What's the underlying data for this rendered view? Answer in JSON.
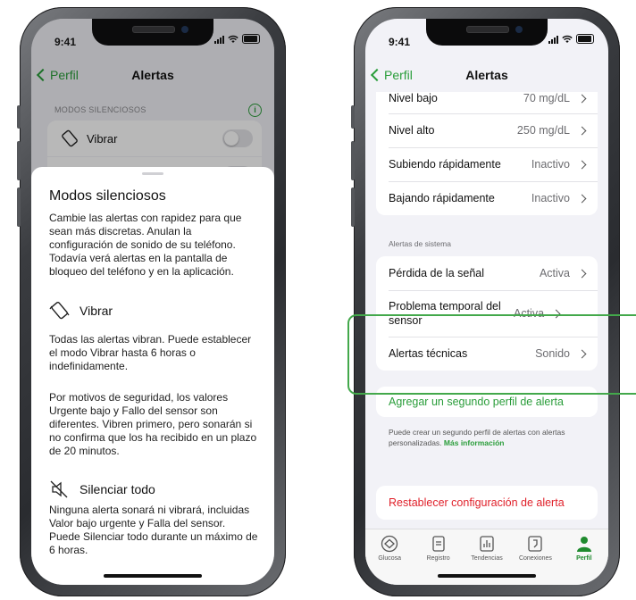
{
  "status_time": "9:41",
  "left": {
    "nav": {
      "back": "Perfil",
      "title": "Alertas"
    },
    "section_header": "MODOS SILENCIOSOS",
    "bg_row_label": "Vibrar",
    "sheet": {
      "title": "Modos silenciosos",
      "intro": "Cambie las alertas con rapidez para que sean más discretas. Anulan la configuración de sonido de su teléfono. Todavía verá alertas en la pantalla de bloqueo del teléfono y en la aplicación.",
      "vibrate_heading": "Vibrar",
      "vibrate_text": "Todas las alertas vibran. Puede establecer el modo Vibrar hasta 6 horas o indefinidamente.",
      "vibrate_note": "Por motivos de seguridad, los valores Urgente bajo y Fallo del sensor son diferentes. Vibren primero, pero sonarán si no confirma que los ha recibido en un plazo de 20 minutos.",
      "mute_heading": "Silenciar todo",
      "mute_text": "Ninguna alerta sonará ni vibrará, incluidas Valor bajo urgente y Falla del sensor. Puede Silenciar todo durante un máximo de 6 horas."
    }
  },
  "right": {
    "nav": {
      "back": "Perfil",
      "title": "Alertas"
    },
    "glucose_rows": [
      {
        "label": "Nivel bajo",
        "value": "70 mg/dL"
      },
      {
        "label": "Nivel alto",
        "value": "250 mg/dL"
      },
      {
        "label": "Subiendo rápidamente",
        "value": "Inactivo"
      },
      {
        "label": "Bajando rápidamente",
        "value": "Inactivo"
      }
    ],
    "system_label": "Alertas de sistema",
    "system_rows": [
      {
        "label": "Pérdida de la señal",
        "value": "Activa"
      },
      {
        "label": "Problema temporal del sensor",
        "value": "Activa"
      },
      {
        "label": "Alertas técnicas",
        "value": "Sonido"
      }
    ],
    "add_profile": "Agregar un segundo perfil de alerta",
    "add_profile_note": "Puede crear un segundo perfil de alertas con alertas personalizadas.",
    "more_info": "Más información",
    "reset": "Restablecer configuración de alerta",
    "tabs": [
      {
        "label": "Glucosa",
        "icon": "glucose-icon"
      },
      {
        "label": "Registro",
        "icon": "log-icon"
      },
      {
        "label": "Tendencias",
        "icon": "trends-icon"
      },
      {
        "label": "Conexiones",
        "icon": "connections-icon"
      },
      {
        "label": "Perfil",
        "icon": "profile-icon"
      }
    ],
    "active_tab": "Perfil"
  },
  "colors": {
    "accent": "#2a9d3a",
    "danger": "#e0202a",
    "highlight": "#43a84b"
  }
}
